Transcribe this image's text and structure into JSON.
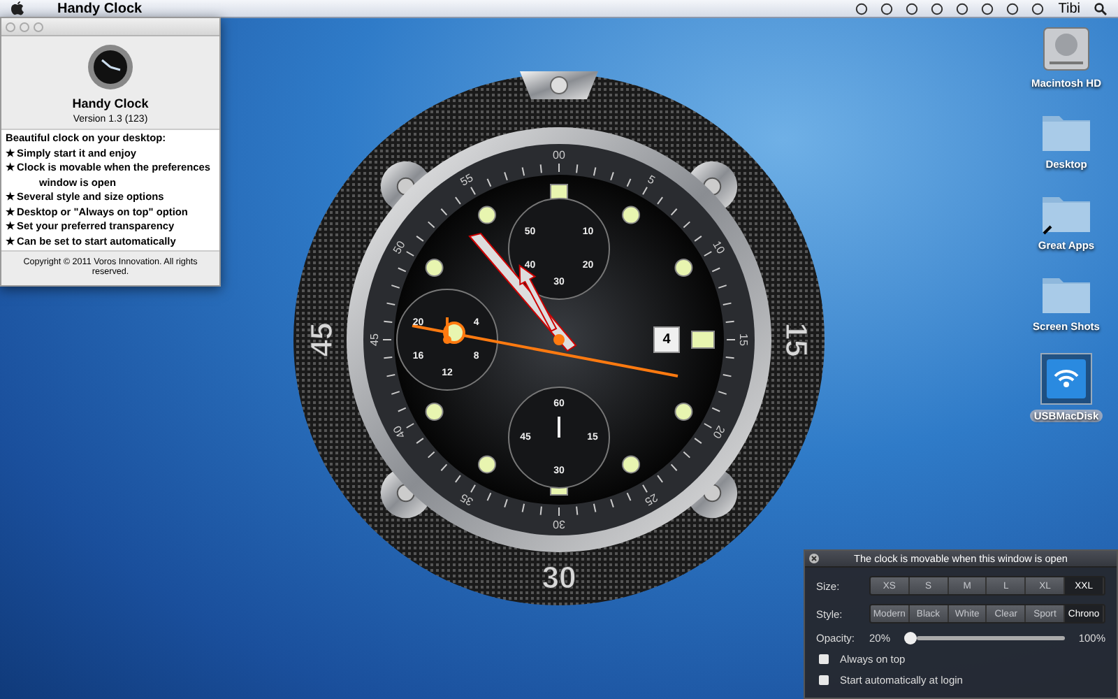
{
  "menu_bar": {
    "app_name": "Handy Clock",
    "user": "Tibi"
  },
  "about_window": {
    "title": "Handy Clock",
    "version": "Version 1.3 (123)",
    "intro": "Beautiful clock on your desktop:",
    "features": [
      "★ Simply start it and enjoy",
      "★ Clock is movable when the preferences window is open",
      "★ Several style and size options",
      "★ Desktop or \"Always on top\" option",
      "★ Set your preferred transparency",
      "★ Can be set to start automatically"
    ],
    "copyright": "Copyright © 2011 Voros Innovation. All rights reserved."
  },
  "clock": {
    "bezel_labels": [
      "15",
      "30",
      "45"
    ],
    "minute_labels": [
      "00",
      "5",
      "10",
      "15",
      "20",
      "25",
      "30",
      "35",
      "40",
      "45",
      "50",
      "55"
    ],
    "date": "4",
    "subdials": [
      {
        "labels": [
          "10",
          "20",
          "30",
          "40",
          "50"
        ]
      },
      {
        "labels": [
          "4",
          "8",
          "12",
          "16",
          "20"
        ]
      },
      {
        "labels": [
          "60",
          "15",
          "30",
          "45"
        ]
      }
    ]
  },
  "desktop_icons": [
    {
      "label": "Macintosh HD",
      "kind": "drive",
      "selected": false
    },
    {
      "label": "Desktop",
      "kind": "folder",
      "selected": false
    },
    {
      "label": "Great Apps",
      "kind": "alias",
      "selected": false
    },
    {
      "label": "Screen Shots",
      "kind": "folder",
      "selected": false
    },
    {
      "label": "USBMacDisk",
      "kind": "usb",
      "selected": true
    }
  ],
  "preferences": {
    "title": "The clock is movable when this window is open",
    "size_label": "Size:",
    "sizes": [
      {
        "label": "XS",
        "selected": false
      },
      {
        "label": "S",
        "selected": false
      },
      {
        "label": "M",
        "selected": false
      },
      {
        "label": "L",
        "selected": false
      },
      {
        "label": "XL",
        "selected": false
      },
      {
        "label": "XXL",
        "selected": true
      }
    ],
    "style_label": "Style:",
    "styles": [
      {
        "label": "Modern",
        "selected": false
      },
      {
        "label": "Black",
        "selected": false
      },
      {
        "label": "White",
        "selected": false
      },
      {
        "label": "Clear",
        "selected": false
      },
      {
        "label": "Sport",
        "selected": false
      },
      {
        "label": "Chrono",
        "selected": true
      }
    ],
    "opacity": {
      "label": "Opacity:",
      "min": "20%",
      "max": "100%",
      "level": 0
    },
    "options": [
      {
        "label": "Always on top",
        "checked": false
      },
      {
        "label": "Start automatically at login",
        "checked": false
      }
    ]
  }
}
